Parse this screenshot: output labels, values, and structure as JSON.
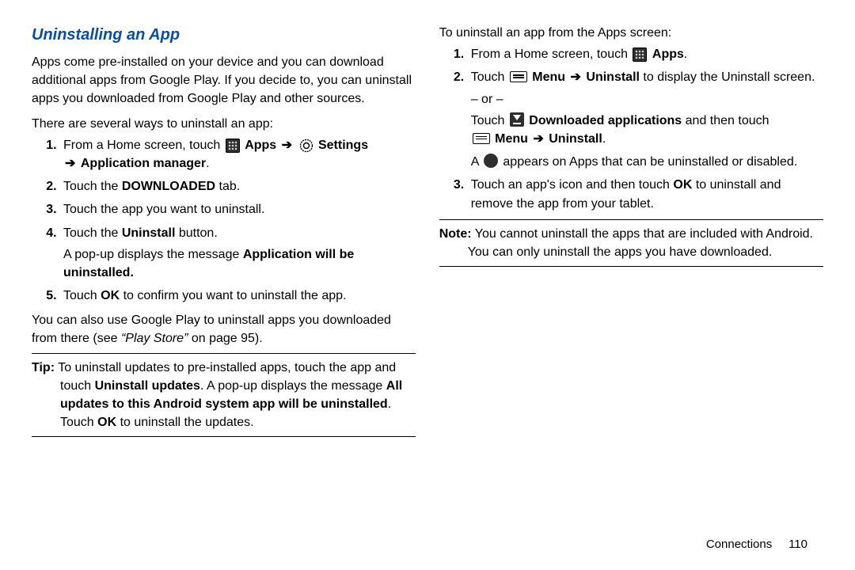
{
  "heading": "Uninstalling an App",
  "left": {
    "intro": "Apps come pre-installed on your device and you can download additional apps from Google Play. If you decide to, you can uninstall apps you downloaded from Google Play and other sources.",
    "lead": "There are several ways to uninstall an app:",
    "step1_a": "From a Home screen, touch ",
    "apps_label": "Apps",
    "arrow": "➔",
    "settings_label": "Settings",
    "step1_b": "Application manager",
    "period": ".",
    "step2_a": "Touch the ",
    "step2_b": "DOWNLOADED",
    "step2_c": " tab.",
    "step3": "Touch the app you want to uninstall.",
    "step4_a": "Touch the ",
    "step4_b": "Uninstall",
    "step4_c": " button.",
    "step4_sub_a": "A pop-up displays the message ",
    "step4_sub_b": "Application will be uninstalled.",
    "step5_a": "Touch ",
    "step5_b": "OK",
    "step5_c": " to confirm you want to uninstall the app.",
    "also_a": "You can also use Google Play to uninstall apps you downloaded from there (see ",
    "also_b": "“Play Store”",
    "also_c": " on page 95).",
    "tip_label": "Tip:",
    "tip_a": " To uninstall updates to pre-installed apps, touch the app and touch ",
    "tip_b": "Uninstall updates",
    "tip_c": ". A pop-up displays the message ",
    "tip_d": "All updates to this Android system app will be uninstalled",
    "tip_e": ". Touch ",
    "tip_f": "OK",
    "tip_g": " to uninstall the updates."
  },
  "right": {
    "intro": "To uninstall an app from the Apps screen:",
    "step1_a": "From a Home screen, touch ",
    "apps_label": "Apps",
    "period": ".",
    "step2_a": "Touch ",
    "menu_label": "Menu",
    "arrow": "➔",
    "uninstall_label": "Uninstall",
    "step2_b": " to display the Uninstall screen.",
    "or": "– or –",
    "step2_alt_a": "Touch ",
    "downloaded_apps": "Downloaded applications",
    "step2_alt_b": " and then touch ",
    "menu_label2": "Menu",
    "uninstall_label2": "Uninstall",
    "appears_a": "A ",
    "appears_b": " appears on Apps that can be uninstalled or disabled.",
    "step3_a": "Touch an app's icon and then touch ",
    "step3_b": "OK",
    "step3_c": " to uninstall and remove the app from your tablet.",
    "note_label": "Note:",
    "note_body": " You cannot uninstall the apps that are included with Android. You can only uninstall the apps you have downloaded."
  },
  "footer": {
    "section": "Connections",
    "page": "110"
  }
}
